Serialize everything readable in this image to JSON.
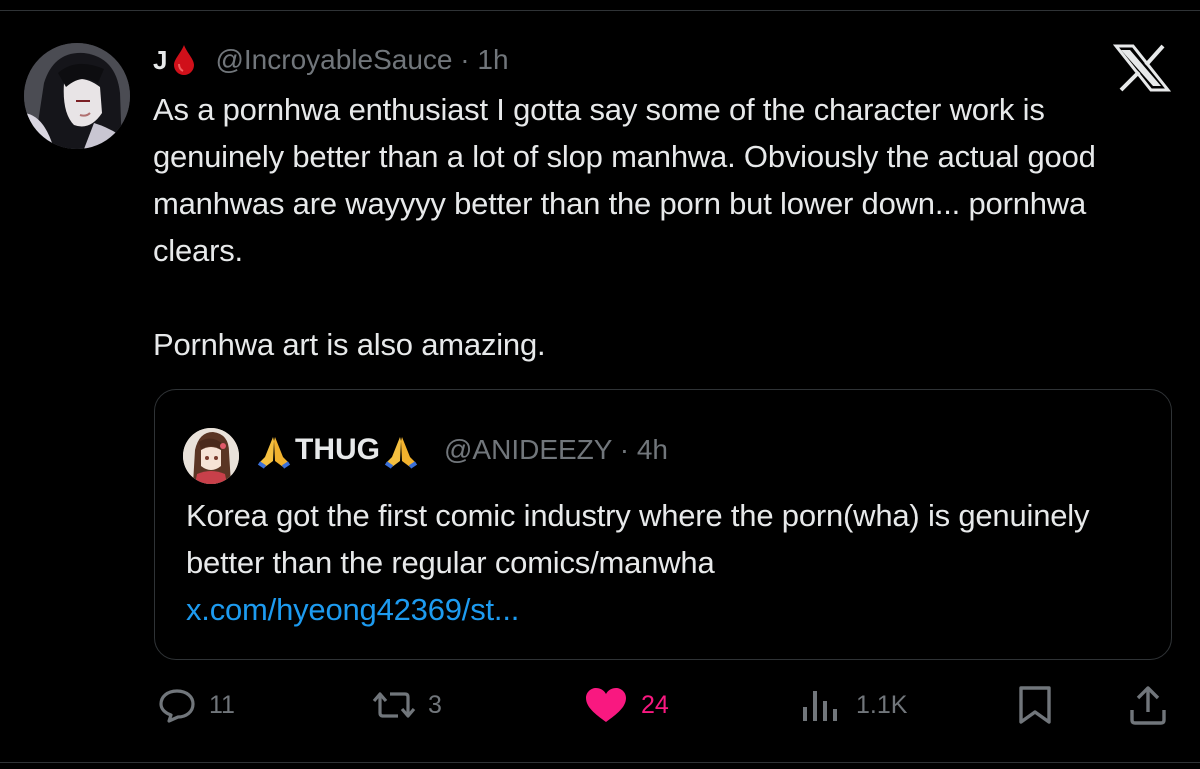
{
  "tweet": {
    "author": {
      "display_name": "J",
      "name_emoji": "blood-drop",
      "handle": "@IncroyableSauce",
      "time": "1h"
    },
    "text": "As a pornhwa enthusiast I gotta say some of the character work is genuinely better than a lot of slop manhwa. Obviously the actual good manhwas are wayyyy better than the porn but lower down... pornhwa clears.\n\nPornhwa art is also amazing.",
    "platform_logo": "x-logo"
  },
  "quote": {
    "author": {
      "display_name": "THUG",
      "name_emoji": "folded-hands",
      "handle": "@ANIDEEZY",
      "time": "4h"
    },
    "text": "Korea got the first comic industry where the porn(wha) is genuinely better than the regular comics/manwha",
    "link": "x.com/hyeong42369/st..."
  },
  "actions": {
    "replies": "11",
    "reposts": "3",
    "likes": "24",
    "views": "1.1K"
  },
  "colors": {
    "background": "#000000",
    "text": "#e7e9ea",
    "muted": "#71767b",
    "link": "#1d9bf0",
    "like": "#f91880",
    "border": "#2f3336",
    "blood": "#d0101a",
    "folded_hands": "#f5c040"
  }
}
